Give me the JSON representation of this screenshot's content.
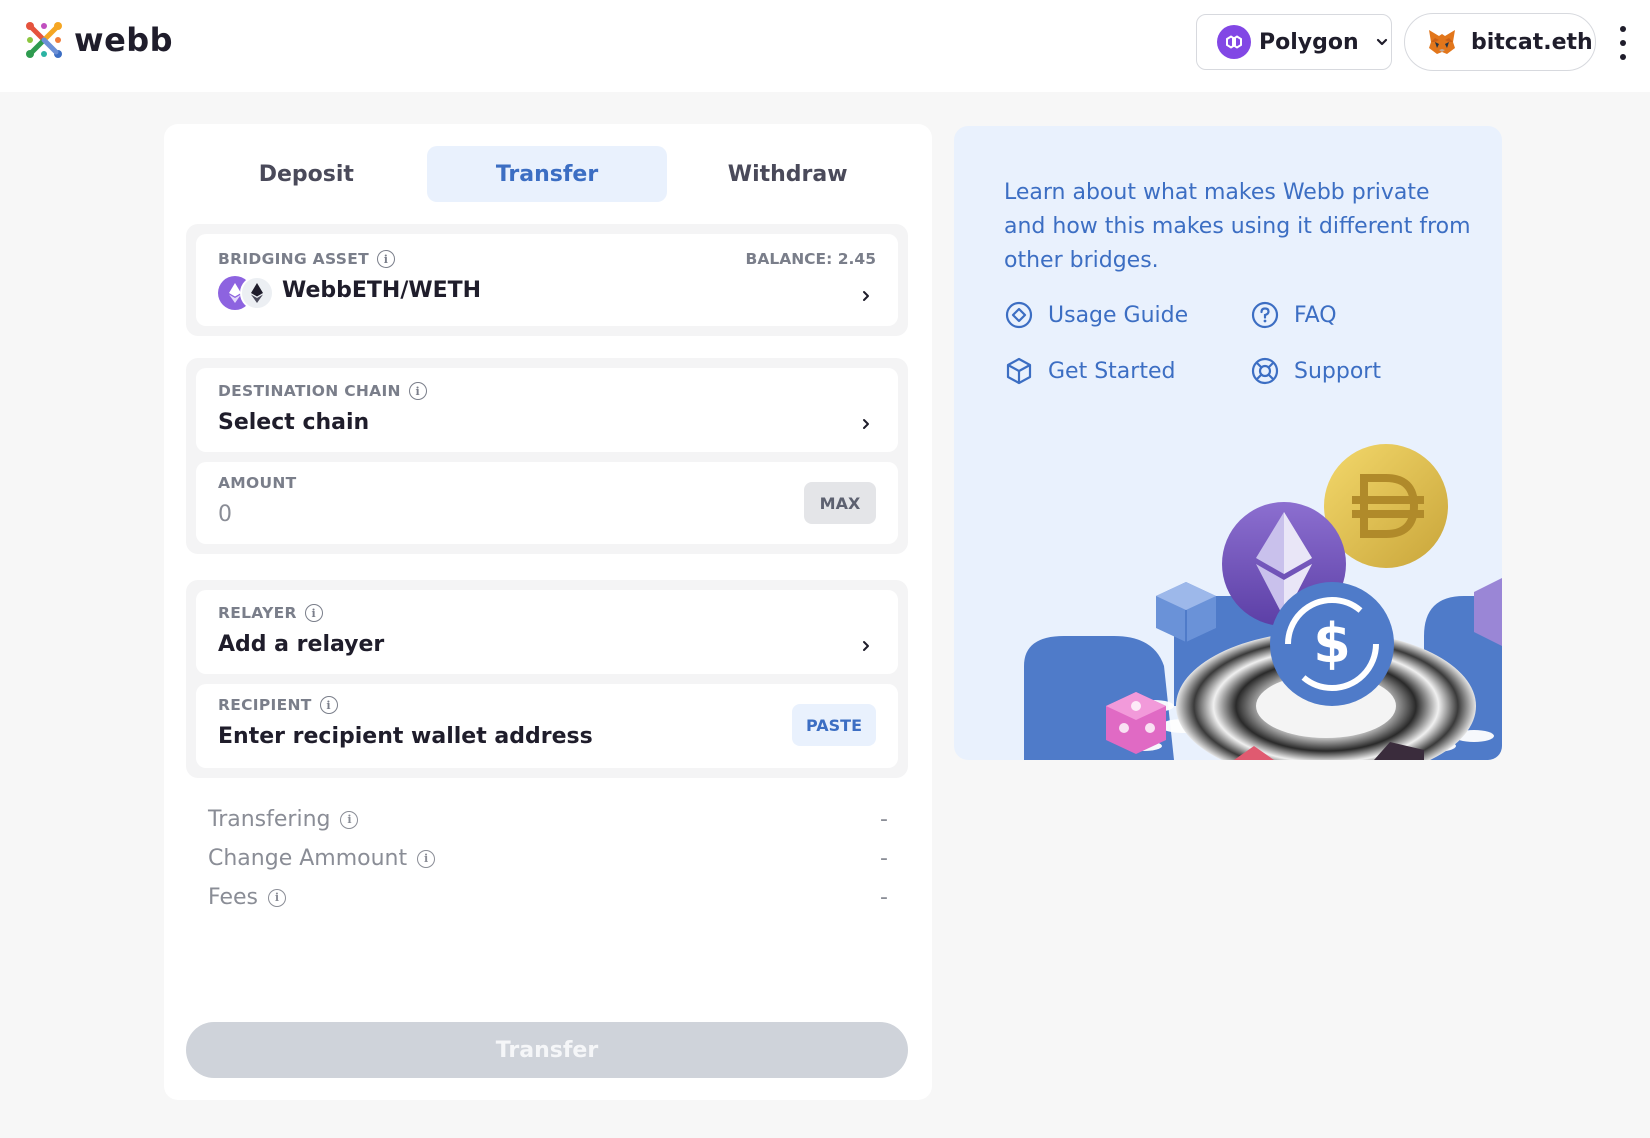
{
  "header": {
    "logo_text": "webb",
    "network": {
      "label": "Polygon",
      "icon": "polygon-icon",
      "color": "#8247e5"
    },
    "wallet": {
      "label": "bitcat.eth",
      "icon": "metamask-fox-icon"
    },
    "menu_icon": "more-vertical-icon"
  },
  "tabs": [
    {
      "label": "Deposit",
      "active": false
    },
    {
      "label": "Transfer",
      "active": true
    },
    {
      "label": "Withdraw",
      "active": false
    }
  ],
  "bridging_asset": {
    "label": "BRIDGING ASSET",
    "balance": "BALANCE: 2.45",
    "value": "WebbETH/WETH"
  },
  "destination_chain": {
    "label": "DESTINATION CHAIN",
    "value": "Select chain"
  },
  "amount": {
    "label": "AMOUNT",
    "placeholder": "0",
    "max_label": "MAX"
  },
  "relayer": {
    "label": "RELAYER",
    "value": "Add a relayer"
  },
  "recipient": {
    "label": "RECIPIENT",
    "placeholder": "Enter recipient wallet address",
    "paste_label": "PASTE"
  },
  "info_rows": [
    {
      "label": "Transfering",
      "value": "-"
    },
    {
      "label": "Change Ammount",
      "value": "-"
    },
    {
      "label": "Fees",
      "value": "-"
    }
  ],
  "submit_label": "Transfer",
  "side_panel": {
    "text": "Learn about what makes Webb private and how this makes using it different from other bridges.",
    "links": {
      "usage_guide": "Usage Guide",
      "faq": "FAQ",
      "get_started": "Get Started",
      "support": "Support"
    }
  },
  "colors": {
    "accent": "#3c6ec3",
    "accent_bg": "#e9f1fd",
    "button_disabled": "#cfd3da",
    "polygon": "#8247e5"
  }
}
